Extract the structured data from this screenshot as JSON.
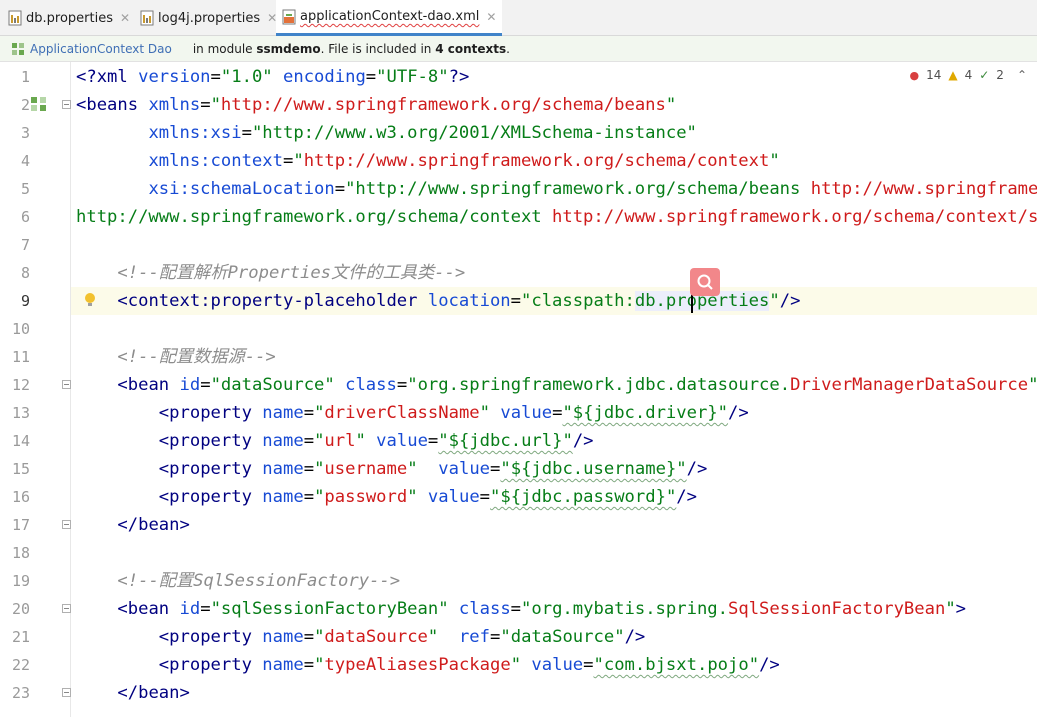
{
  "tabs": [
    {
      "label": "db.properties",
      "active": false
    },
    {
      "label": "log4j.properties",
      "active": false
    },
    {
      "label": "applicationContext-dao.xml",
      "active": true
    }
  ],
  "infobar": {
    "context_link": "ApplicationContext Dao",
    "msg_in_module": "in module ",
    "module_name": "ssmdemo",
    "msg_included": ". File is included in ",
    "contexts_count": "4 contexts",
    "msg_end": "."
  },
  "inspections": {
    "errors": "14",
    "warnings": "4",
    "typos": "2"
  },
  "line_numbers": [
    "1",
    "2",
    "3",
    "4",
    "5",
    "6",
    "7",
    "8",
    "9",
    "10",
    "11",
    "12",
    "13",
    "14",
    "15",
    "16",
    "17",
    "18",
    "19",
    "20",
    "21",
    "22",
    "23"
  ],
  "code": {
    "l1": {
      "open": "<?",
      "tag": "xml",
      "a1": " version",
      "eq1": "=",
      "v1": "\"1.0\"",
      "a2": " encoding",
      "eq2": "=",
      "v2": "\"UTF-8\"",
      "close": "?>"
    },
    "l2": {
      "open": "<",
      "tag": "beans",
      "a1": " xmlns",
      "eq": "=",
      "q1": "\"",
      "url": "http://www.springframework.org/schema/beans",
      "q2": "\""
    },
    "l3": {
      "indent": "       ",
      "a1": "xmlns:xsi",
      "eq": "=",
      "v": "\"http://www.w3.org/2001/XMLSchema-instance\""
    },
    "l4": {
      "indent": "       ",
      "a1": "xmlns:context",
      "eq": "=",
      "q1": "\"",
      "url": "http://www.springframework.org/schema/context",
      "q2": "\""
    },
    "l5": {
      "indent": "       ",
      "a1": "xsi:schemaLocation",
      "eq": "=",
      "v": "\"http://www.springframework.org/schema/beans ",
      "url": "http://www.springframework.org/schema/beans/spring-beans.xsd"
    },
    "l6": {
      "v": "http://www.springframework.org/schema/context ",
      "url": "http://www.springframework.org/schema/context/spring-context.xsd"
    },
    "l8": {
      "indent": "    ",
      "comment": "<!--配置解析Properties文件的工具类-->"
    },
    "l9": {
      "indent": "    ",
      "open": "<",
      "tag": "context:property-placeholder",
      "a1": " location",
      "eq": "=",
      "v_pre": "\"classpath:",
      "v_hl1": "db",
      "v_hl2": ".properties",
      "v_end": "\"",
      "close": "/>"
    },
    "l11": {
      "indent": "    ",
      "comment": "<!--配置数据源-->"
    },
    "l12": {
      "indent": "    ",
      "open": "<",
      "tag": "bean",
      "a1": " id",
      "eq1": "=",
      "v1": "\"dataSource\"",
      "a2": " class",
      "eq2": "=",
      "v2": "\"org.springframework.jdbc.datasource.",
      "url": "DriverManagerDataSource",
      "v_end": "\"",
      "close": ">"
    },
    "l13": {
      "indent": "        ",
      "open": "<",
      "tag": "property",
      "a1": " name",
      "eq1": "=",
      "v1q": "\"",
      "v1": "driverClassName",
      "v1e": "\"",
      "a2": " value",
      "eq2": "=",
      "v2": "\"${jdbc.driver}\"",
      "close": "/>"
    },
    "l14": {
      "indent": "        ",
      "open": "<",
      "tag": "property",
      "a1": " name",
      "eq1": "=",
      "v1q": "\"",
      "v1": "url",
      "v1e": "\"",
      "a2": " value",
      "eq2": "=",
      "v2": "\"${jdbc.url}\"",
      "close": "/>"
    },
    "l15": {
      "indent": "        ",
      "open": "<",
      "tag": "property",
      "a1": " name",
      "eq1": "=",
      "v1q": "\"",
      "v1": "username",
      "v1e": "\"",
      "a2": "  value",
      "eq2": "=",
      "v2": "\"${jdbc.username}\"",
      "close": "/>"
    },
    "l16": {
      "indent": "        ",
      "open": "<",
      "tag": "property",
      "a1": " name",
      "eq1": "=",
      "v1q": "\"",
      "v1": "password",
      "v1e": "\"",
      "a2": " value",
      "eq2": "=",
      "v2": "\"${jdbc.password}\"",
      "close": "/>"
    },
    "l17": {
      "indent": "    ",
      "text": "</",
      "tag": "bean",
      "close": ">"
    },
    "l19": {
      "indent": "    ",
      "comment": "<!--配置SqlSessionFactory-->"
    },
    "l20": {
      "indent": "    ",
      "open": "<",
      "tag": "bean",
      "a1": " id",
      "eq1": "=",
      "v1": "\"sqlSessionFactoryBean\"",
      "a2": " class",
      "eq2": "=",
      "v2": "\"org.mybatis.spring.",
      "url": "SqlSessionFactoryBean",
      "v_end": "\"",
      "close": ">"
    },
    "l21": {
      "indent": "        ",
      "open": "<",
      "tag": "property",
      "a1": " name",
      "eq1": "=",
      "v1q": "\"",
      "v1": "dataSource",
      "v1e": "\"",
      "a2": "  ref",
      "eq2": "=",
      "v2": "\"dataSource\"",
      "close": "/>"
    },
    "l22": {
      "indent": "        ",
      "open": "<",
      "tag": "property",
      "a1": " name",
      "eq1": "=",
      "v1q": "\"",
      "v1": "typeAliasesPackage",
      "v1e": "\"",
      "a2": " value",
      "eq2": "=",
      "v2": "\"com.bjsxt.pojo\"",
      "close": "/>"
    },
    "l23": {
      "indent": "    ",
      "text": "</",
      "tag": "bean",
      "close": ">"
    }
  },
  "colors": {
    "tag": "#000080",
    "attr": "#174ad4",
    "value": "#067d17",
    "url": "#cf1b1b",
    "comment": "#8c8c8c",
    "accent": "#4083c9"
  }
}
